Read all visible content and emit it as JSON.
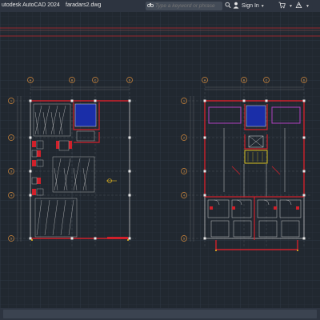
{
  "titlebar": {
    "app_title": "utodesk AutoCAD 2024",
    "file_name": "faradars2.dwg",
    "search_placeholder": "Type a keyword or phrase",
    "sign_in_label": "Sign In",
    "search_icon": "binoculars-icon",
    "user_icon": "user-icon",
    "icons": [
      "search-icon",
      "user-icon",
      "cart-icon",
      "help-icon"
    ]
  },
  "colors": {
    "canvas_bg": "#212830",
    "titlebar_bg": "#2d3440",
    "wall_red": "#d0202a",
    "grid_bubble": "#d68a3b",
    "stairs_blue": "#1a2ea8",
    "room_magenta": "#b040c0"
  },
  "drawing": {
    "grid_letters_top": [
      "A",
      "B",
      "C",
      "D"
    ],
    "grid_numbers_side": [
      "1",
      "2",
      "3",
      "4",
      "5"
    ],
    "plans": [
      {
        "name": "left-plan"
      },
      {
        "name": "right-plan"
      }
    ]
  }
}
